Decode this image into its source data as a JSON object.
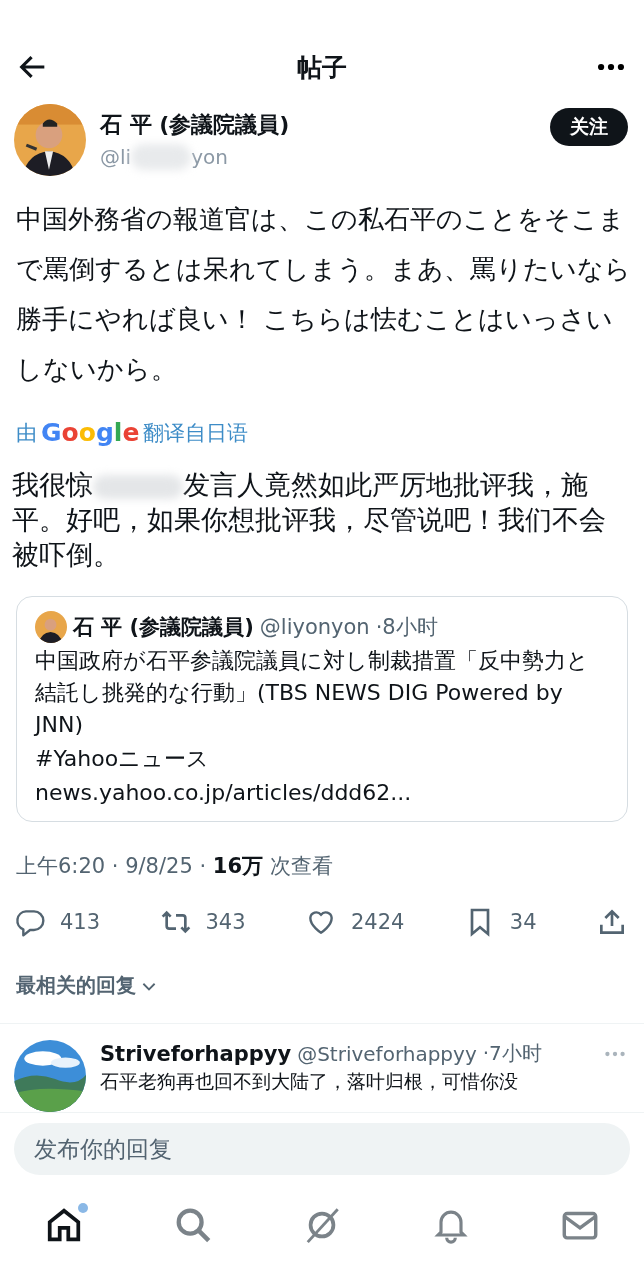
{
  "header": {
    "title": "帖子"
  },
  "post": {
    "author": "石 平 (参議院議員)",
    "handle_start": "@li",
    "handle_end": "yon",
    "follow_button": "关注",
    "text": "中国外務省の報道官は、この私石平のことをそこまで罵倒するとは呆れてしまう。まあ、罵りたいなら勝手にやれば良い！ こちらは怯むことはいっさいしないから。",
    "translate_prefix": "由",
    "translate_brand": "Google",
    "translate_suffix": "翻译自日语",
    "translation_start": "我很惊",
    "translation_rest": "发言人竟然如此严厉地批评我，施平。好吧，如果你想批评我，尽管说吧！我们不会被吓倒。",
    "quote": {
      "author": "石 平 (参議院議員)",
      "handle": "@liyonyon",
      "time": "·8小时",
      "text": "中国政府が石平参議院議員に対し制裁措置「反中勢力と結託し挑発的な行動」(TBS NEWS DIG Powered by JNN)",
      "hashtag": "#Yahooニュース",
      "link": "news.yahoo.co.jp/articles/ddd62..."
    },
    "time": "上午6:20 · 9/8/25 · ",
    "views": "16万",
    "views_label": " 次查看",
    "actions": [
      {
        "kind": "reply",
        "count": "413"
      },
      {
        "kind": "repost",
        "count": "343"
      },
      {
        "kind": "like",
        "count": "2424"
      },
      {
        "kind": "bookmark",
        "count": "34"
      },
      {
        "kind": "share"
      }
    ]
  },
  "sort": {
    "label": "最相关的回复"
  },
  "replies": [
    {
      "name": "Striveforhappyy",
      "handle": "@Striveforhappyy",
      "time": "·7小时",
      "text": "石平老狗再也回不到大陆了，落叶归根，可惜你没"
    }
  ],
  "reply_field": {
    "placeholder": "发布你的回复"
  },
  "nav": [
    {
      "kind": "home",
      "selected": true,
      "badge": true
    },
    {
      "kind": "search",
      "selected": false,
      "badge": false
    },
    {
      "kind": "grok",
      "selected": false,
      "badge": false
    },
    {
      "kind": "bell",
      "selected": false,
      "badge": false
    },
    {
      "kind": "mail",
      "selected": false,
      "badge": false
    }
  ]
}
